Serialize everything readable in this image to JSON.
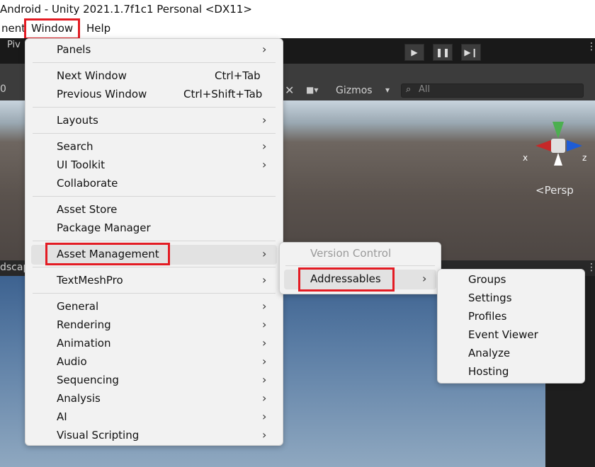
{
  "title": "Android - Unity 2021.1.7f1c1 Personal <DX11>",
  "menubar": {
    "items": [
      "nent",
      "Window",
      "Help"
    ]
  },
  "toolbar": {
    "pivot_label": "Piv",
    "play": "▶",
    "pause": "❚❚",
    "step": "▶❙"
  },
  "scene_toolbar": {
    "layers_count": "0",
    "gizmos_label": "Gizmos",
    "search_placeholder": "All",
    "persp_label": "Persp",
    "axis_x": "x",
    "axis_z": "z"
  },
  "game_view": {
    "tab_label": "dscap"
  },
  "window_menu": {
    "items": [
      {
        "label": "Panels",
        "submenu": true
      },
      {
        "label": "Next Window",
        "shortcut": "Ctrl+Tab"
      },
      {
        "label": "Previous Window",
        "shortcut": "Ctrl+Shift+Tab"
      },
      {
        "label": "Layouts",
        "submenu": true
      },
      {
        "label": "Search",
        "submenu": true
      },
      {
        "label": "UI Toolkit",
        "submenu": true
      },
      {
        "label": "Collaborate"
      },
      {
        "label": "Asset Store"
      },
      {
        "label": "Package Manager"
      },
      {
        "label": "Asset Management",
        "submenu": true
      },
      {
        "label": "TextMeshPro",
        "submenu": true
      },
      {
        "label": "General",
        "submenu": true
      },
      {
        "label": "Rendering",
        "submenu": true
      },
      {
        "label": "Animation",
        "submenu": true
      },
      {
        "label": "Audio",
        "submenu": true
      },
      {
        "label": "Sequencing",
        "submenu": true
      },
      {
        "label": "Analysis",
        "submenu": true
      },
      {
        "label": "AI",
        "submenu": true
      },
      {
        "label": "Visual Scripting",
        "submenu": true
      }
    ]
  },
  "asset_management_menu": {
    "items": [
      {
        "label": "Version Control",
        "disabled": true
      },
      {
        "label": "Addressables",
        "submenu": true
      }
    ]
  },
  "addressables_menu": {
    "items": [
      "Groups",
      "Settings",
      "Profiles",
      "Event Viewer",
      "Analyze",
      "Hosting"
    ]
  },
  "colors": {
    "highlight": "#e31b23",
    "menu_bg": "#f2f2f2"
  }
}
